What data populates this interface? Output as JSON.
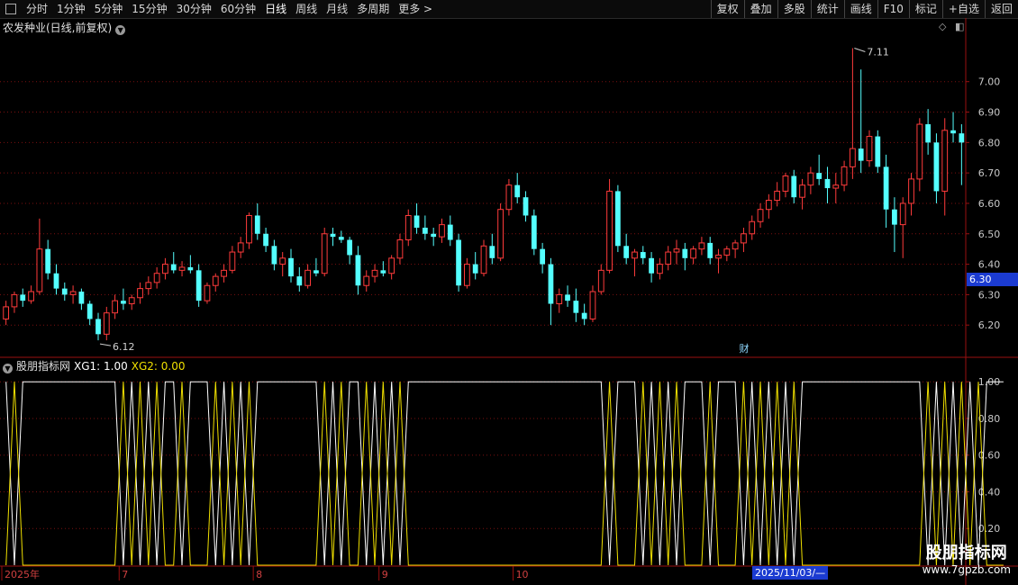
{
  "toolbar": {
    "periods": [
      "分时",
      "1分钟",
      "5分钟",
      "15分钟",
      "30分钟",
      "60分钟",
      "日线",
      "周线",
      "月线",
      "多周期",
      "更多 >"
    ],
    "active_period": "日线",
    "buttons": [
      "复权",
      "叠加",
      "多股",
      "统计",
      "画线",
      "F10",
      "标记",
      "+自选",
      "返回"
    ]
  },
  "main_chart": {
    "title": "农发种业(日线,前复权)",
    "y_ticks": [
      "7.00",
      "6.90",
      "6.80",
      "6.70",
      "6.60",
      "6.50",
      "6.40",
      "6.30",
      "6.20"
    ],
    "current_price": "6.30",
    "high_label": "7.11",
    "low_label": "6.12",
    "marker": "财"
  },
  "indicator": {
    "name": "股朋指标网",
    "xg1_label": "XG1: 1.00",
    "xg2_label": "XG2: 0.00",
    "y_ticks": [
      "1.00",
      "0.80",
      "0.60",
      "0.40",
      "0.20"
    ]
  },
  "x_axis": {
    "labels": [
      "2025年",
      "7",
      "8",
      "9",
      "10"
    ],
    "cursor_date": "2025/11/03/—"
  },
  "watermark": {
    "line1": "股朋指标网",
    "line2": "www.7gpzb.com"
  },
  "colors": {
    "up": "#ff3b3b",
    "down": "#54ffff",
    "xg1": "#ffffff",
    "xg2": "#f0e000",
    "grid": "#7a1010",
    "accent": "#1b3bd1"
  },
  "chart_data": [
    {
      "type": "candlestick",
      "title": "农发种业(日线,前复权)",
      "ylim": [
        6.1,
        7.15
      ],
      "x_labels": [
        "2025年",
        "7",
        "8",
        "9",
        "10"
      ],
      "ohlc": [
        [
          6.22,
          6.28,
          6.2,
          6.26
        ],
        [
          6.26,
          6.31,
          6.24,
          6.3
        ],
        [
          6.3,
          6.32,
          6.26,
          6.28
        ],
        [
          6.28,
          6.33,
          6.27,
          6.31
        ],
        [
          6.31,
          6.55,
          6.3,
          6.45
        ],
        [
          6.45,
          6.48,
          6.35,
          6.37
        ],
        [
          6.37,
          6.4,
          6.3,
          6.32
        ],
        [
          6.32,
          6.34,
          6.28,
          6.3
        ],
        [
          6.3,
          6.33,
          6.27,
          6.31
        ],
        [
          6.31,
          6.32,
          6.25,
          6.27
        ],
        [
          6.27,
          6.28,
          6.2,
          6.22
        ],
        [
          6.22,
          6.24,
          6.15,
          6.17
        ],
        [
          6.17,
          6.26,
          6.15,
          6.24
        ],
        [
          6.24,
          6.3,
          6.22,
          6.28
        ],
        [
          6.28,
          6.32,
          6.25,
          6.27
        ],
        [
          6.27,
          6.3,
          6.25,
          6.29
        ],
        [
          6.29,
          6.34,
          6.27,
          6.32
        ],
        [
          6.32,
          6.36,
          6.3,
          6.34
        ],
        [
          6.34,
          6.39,
          6.32,
          6.37
        ],
        [
          6.37,
          6.42,
          6.35,
          6.4
        ],
        [
          6.4,
          6.44,
          6.37,
          6.38
        ],
        [
          6.38,
          6.41,
          6.36,
          6.39
        ],
        [
          6.39,
          6.43,
          6.37,
          6.38
        ],
        [
          6.38,
          6.4,
          6.26,
          6.28
        ],
        [
          6.28,
          6.34,
          6.27,
          6.33
        ],
        [
          6.33,
          6.37,
          6.31,
          6.36
        ],
        [
          6.36,
          6.4,
          6.34,
          6.38
        ],
        [
          6.38,
          6.46,
          6.37,
          6.44
        ],
        [
          6.44,
          6.49,
          6.42,
          6.47
        ],
        [
          6.47,
          6.57,
          6.45,
          6.56
        ],
        [
          6.56,
          6.6,
          6.48,
          6.5
        ],
        [
          6.5,
          6.52,
          6.44,
          6.46
        ],
        [
          6.46,
          6.48,
          6.38,
          6.4
        ],
        [
          6.4,
          6.44,
          6.36,
          6.42
        ],
        [
          6.42,
          6.45,
          6.34,
          6.36
        ],
        [
          6.36,
          6.39,
          6.31,
          6.33
        ],
        [
          6.33,
          6.4,
          6.32,
          6.38
        ],
        [
          6.38,
          6.42,
          6.36,
          6.37
        ],
        [
          6.37,
          6.52,
          6.36,
          6.5
        ],
        [
          6.5,
          6.52,
          6.46,
          6.49
        ],
        [
          6.49,
          6.51,
          6.47,
          6.48
        ],
        [
          6.48,
          6.49,
          6.4,
          6.43
        ],
        [
          6.43,
          6.46,
          6.3,
          6.33
        ],
        [
          6.33,
          6.38,
          6.31,
          6.36
        ],
        [
          6.36,
          6.4,
          6.34,
          6.38
        ],
        [
          6.38,
          6.41,
          6.36,
          6.37
        ],
        [
          6.37,
          6.43,
          6.35,
          6.42
        ],
        [
          6.42,
          6.5,
          6.4,
          6.48
        ],
        [
          6.48,
          6.58,
          6.46,
          6.56
        ],
        [
          6.56,
          6.6,
          6.5,
          6.52
        ],
        [
          6.52,
          6.56,
          6.48,
          6.5
        ],
        [
          6.5,
          6.52,
          6.46,
          6.49
        ],
        [
          6.49,
          6.55,
          6.47,
          6.53
        ],
        [
          6.53,
          6.56,
          6.46,
          6.48
        ],
        [
          6.48,
          6.5,
          6.31,
          6.33
        ],
        [
          6.33,
          6.42,
          6.32,
          6.4
        ],
        [
          6.4,
          6.44,
          6.35,
          6.37
        ],
        [
          6.37,
          6.48,
          6.36,
          6.46
        ],
        [
          6.46,
          6.5,
          6.4,
          6.42
        ],
        [
          6.42,
          6.6,
          6.41,
          6.58
        ],
        [
          6.58,
          6.68,
          6.56,
          6.66
        ],
        [
          6.66,
          6.7,
          6.6,
          6.62
        ],
        [
          6.62,
          6.64,
          6.54,
          6.56
        ],
        [
          6.56,
          6.58,
          6.43,
          6.45
        ],
        [
          6.45,
          6.47,
          6.37,
          6.4
        ],
        [
          6.4,
          6.42,
          6.2,
          6.27
        ],
        [
          6.27,
          6.32,
          6.24,
          6.3
        ],
        [
          6.3,
          6.33,
          6.26,
          6.28
        ],
        [
          6.28,
          6.32,
          6.21,
          6.24
        ],
        [
          6.24,
          6.27,
          6.2,
          6.22
        ],
        [
          6.22,
          6.33,
          6.21,
          6.31
        ],
        [
          6.31,
          6.4,
          6.3,
          6.38
        ],
        [
          6.38,
          6.68,
          6.37,
          6.64
        ],
        [
          6.64,
          6.66,
          6.44,
          6.46
        ],
        [
          6.46,
          6.5,
          6.4,
          6.42
        ],
        [
          6.42,
          6.45,
          6.36,
          6.44
        ],
        [
          6.44,
          6.46,
          6.4,
          6.42
        ],
        [
          6.42,
          6.44,
          6.34,
          6.37
        ],
        [
          6.37,
          6.42,
          6.35,
          6.4
        ],
        [
          6.4,
          6.46,
          6.38,
          6.44
        ],
        [
          6.44,
          6.48,
          6.4,
          6.45
        ],
        [
          6.45,
          6.47,
          6.38,
          6.42
        ],
        [
          6.42,
          6.46,
          6.4,
          6.45
        ],
        [
          6.45,
          6.49,
          6.43,
          6.47
        ],
        [
          6.47,
          6.49,
          6.4,
          6.42
        ],
        [
          6.42,
          6.45,
          6.37,
          6.43
        ],
        [
          6.43,
          6.46,
          6.41,
          6.45
        ],
        [
          6.45,
          6.48,
          6.42,
          6.47
        ],
        [
          6.47,
          6.52,
          6.44,
          6.5
        ],
        [
          6.5,
          6.56,
          6.48,
          6.54
        ],
        [
          6.54,
          6.6,
          6.52,
          6.58
        ],
        [
          6.58,
          6.63,
          6.55,
          6.61
        ],
        [
          6.61,
          6.67,
          6.59,
          6.64
        ],
        [
          6.64,
          6.7,
          6.62,
          6.69
        ],
        [
          6.69,
          6.71,
          6.6,
          6.62
        ],
        [
          6.62,
          6.68,
          6.58,
          6.66
        ],
        [
          6.66,
          6.72,
          6.63,
          6.7
        ],
        [
          6.7,
          6.76,
          6.66,
          6.68
        ],
        [
          6.68,
          6.72,
          6.6,
          6.65
        ],
        [
          6.65,
          6.7,
          6.6,
          6.66
        ],
        [
          6.66,
          6.74,
          6.64,
          6.72
        ],
        [
          6.72,
          7.11,
          6.68,
          6.78
        ],
        [
          6.78,
          7.04,
          6.7,
          6.74
        ],
        [
          6.74,
          6.84,
          6.72,
          6.82
        ],
        [
          6.82,
          6.84,
          6.7,
          6.72
        ],
        [
          6.72,
          6.76,
          6.52,
          6.58
        ],
        [
          6.58,
          6.62,
          6.44,
          6.53
        ],
        [
          6.53,
          6.62,
          6.42,
          6.6
        ],
        [
          6.6,
          6.7,
          6.56,
          6.68
        ],
        [
          6.68,
          6.88,
          6.64,
          6.86
        ],
        [
          6.86,
          6.91,
          6.76,
          6.8
        ],
        [
          6.8,
          6.83,
          6.6,
          6.64
        ],
        [
          6.64,
          6.88,
          6.56,
          6.84
        ],
        [
          6.84,
          6.9,
          6.8,
          6.83
        ],
        [
          6.83,
          6.86,
          6.66,
          6.8
        ]
      ]
    },
    {
      "type": "line",
      "title": "股朋指标网",
      "ylim": [
        0,
        1.05
      ],
      "series": [
        {
          "name": "XG1",
          "values": [
            1,
            0,
            1,
            1,
            1,
            1,
            1,
            1,
            1,
            1,
            1,
            1,
            1,
            1,
            0,
            1,
            0,
            1,
            0,
            1,
            1,
            0,
            1,
            1,
            1,
            0,
            1,
            0,
            1,
            0,
            1,
            1,
            1,
            1,
            1,
            1,
            1,
            1,
            0,
            1,
            0,
            1,
            1,
            0,
            1,
            0,
            1,
            0,
            1,
            1,
            1,
            1,
            1,
            1,
            1,
            1,
            1,
            1,
            1,
            1,
            1,
            1,
            1,
            1,
            1,
            1,
            1,
            1,
            1,
            1,
            1,
            1,
            0,
            1,
            1,
            1,
            0,
            1,
            0,
            1,
            0,
            1,
            1,
            1,
            0,
            1,
            1,
            1,
            0,
            1,
            0,
            1,
            0,
            1,
            0,
            1,
            1,
            1,
            1,
            1,
            1,
            1,
            1,
            1,
            1,
            1,
            1,
            1,
            1,
            1,
            0,
            1,
            0,
            1,
            0,
            1,
            0,
            1,
            1,
            1
          ]
        },
        {
          "name": "XG2",
          "values": [
            0,
            1,
            0,
            0,
            0,
            0,
            0,
            0,
            0,
            0,
            0,
            0,
            0,
            0,
            1,
            0,
            1,
            0,
            1,
            0,
            0,
            1,
            0,
            0,
            0,
            1,
            0,
            1,
            0,
            1,
            0,
            0,
            0,
            0,
            0,
            0,
            0,
            0,
            1,
            0,
            1,
            0,
            0,
            1,
            0,
            1,
            0,
            1,
            0,
            0,
            0,
            0,
            0,
            0,
            0,
            0,
            0,
            0,
            0,
            0,
            0,
            0,
            0,
            0,
            0,
            0,
            0,
            0,
            0,
            0,
            0,
            0,
            1,
            0,
            0,
            0,
            1,
            0,
            1,
            0,
            1,
            0,
            0,
            0,
            1,
            0,
            0,
            0,
            1,
            0,
            1,
            0,
            1,
            0,
            1,
            0,
            0,
            0,
            0,
            0,
            0,
            0,
            0,
            0,
            0,
            0,
            0,
            0,
            0,
            0,
            1,
            0,
            1,
            0,
            1,
            0,
            1,
            0,
            0,
            0
          ]
        }
      ]
    }
  ]
}
